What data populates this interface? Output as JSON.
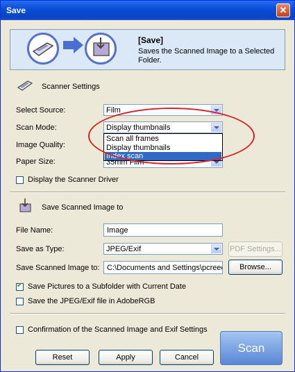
{
  "window": {
    "title": "Save",
    "close_label": "✕"
  },
  "header": {
    "title": "[Save]",
    "description": "Saves the Scanned Image to a Selected Folder."
  },
  "scanner_settings": {
    "heading": "Scanner Settings",
    "source_label": "Select Source:",
    "source_value": "Film",
    "mode_label": "Scan Mode:",
    "mode_value": "Display thumbnails",
    "mode_options": [
      "Scan all frames",
      "Display thumbnails",
      "Index scan"
    ],
    "quality_label": "Image Quality:",
    "paper_label": "Paper Size:",
    "paper_value": "35mm Film",
    "driver_checkbox": "Display the Scanner Driver"
  },
  "save_settings": {
    "heading": "Save Scanned Image to",
    "filename_label": "File Name:",
    "filename_value": "Image",
    "type_label": "Save as Type:",
    "type_value": "JPEG/Exif",
    "pdf_button": "PDF Settings...",
    "path_label": "Save Scanned Image to:",
    "path_value": "C:\\Documents and Settings\\pcreecy",
    "browse_button": "Browse...",
    "subfolder_checkbox": "Save Pictures to a Subfolder with Current Date",
    "adobergb_checkbox": "Save the JPEG/Exif file in AdobeRGB"
  },
  "confirm_checkbox": "Confirmation of the Scanned Image and Exif Settings",
  "buttons": {
    "reset": "Reset",
    "apply": "Apply",
    "cancel": "Cancel",
    "scan": "Scan"
  },
  "checkbox_states": {
    "driver": false,
    "subfolder": true,
    "adobergb": false,
    "confirm": false
  }
}
